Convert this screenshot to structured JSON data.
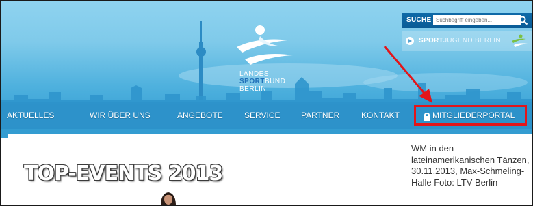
{
  "header": {
    "logo": {
      "line1": "LANDES",
      "line2_sport": "SPORT",
      "line2_bund": "BUND",
      "line3": "BERLIN"
    },
    "search": {
      "label": "SUCHE",
      "placeholder": "Suchbegriff eingeben...",
      "icon": "search-icon"
    },
    "sportjugend": {
      "bold": "SPORT",
      "rest": "JUGEND BERLIN",
      "icon": "play-icon"
    }
  },
  "nav": {
    "items": [
      {
        "label": "AKTUELLES"
      },
      {
        "label": "WIR ÜBER UNS"
      },
      {
        "label": "ANGEBOTE"
      },
      {
        "label": "SERVICE"
      },
      {
        "label": "PARTNER"
      },
      {
        "label": "KONTAKT"
      }
    ],
    "portal": {
      "label": "MITGLIEDERPORTAL",
      "icon": "lock-icon"
    }
  },
  "content": {
    "title": "TOP-EVENTS 2013",
    "caption": "WM in den lateinamerikanischen Tänzen, 30.11.2013, Max-Schmeling-Halle Foto: LTV Berlin"
  },
  "colors": {
    "sky_top": "#8fd3f0",
    "sky_bottom": "#2a97cf",
    "annotation_red": "#e3151a",
    "logo_blue": "#1f6fb8"
  }
}
